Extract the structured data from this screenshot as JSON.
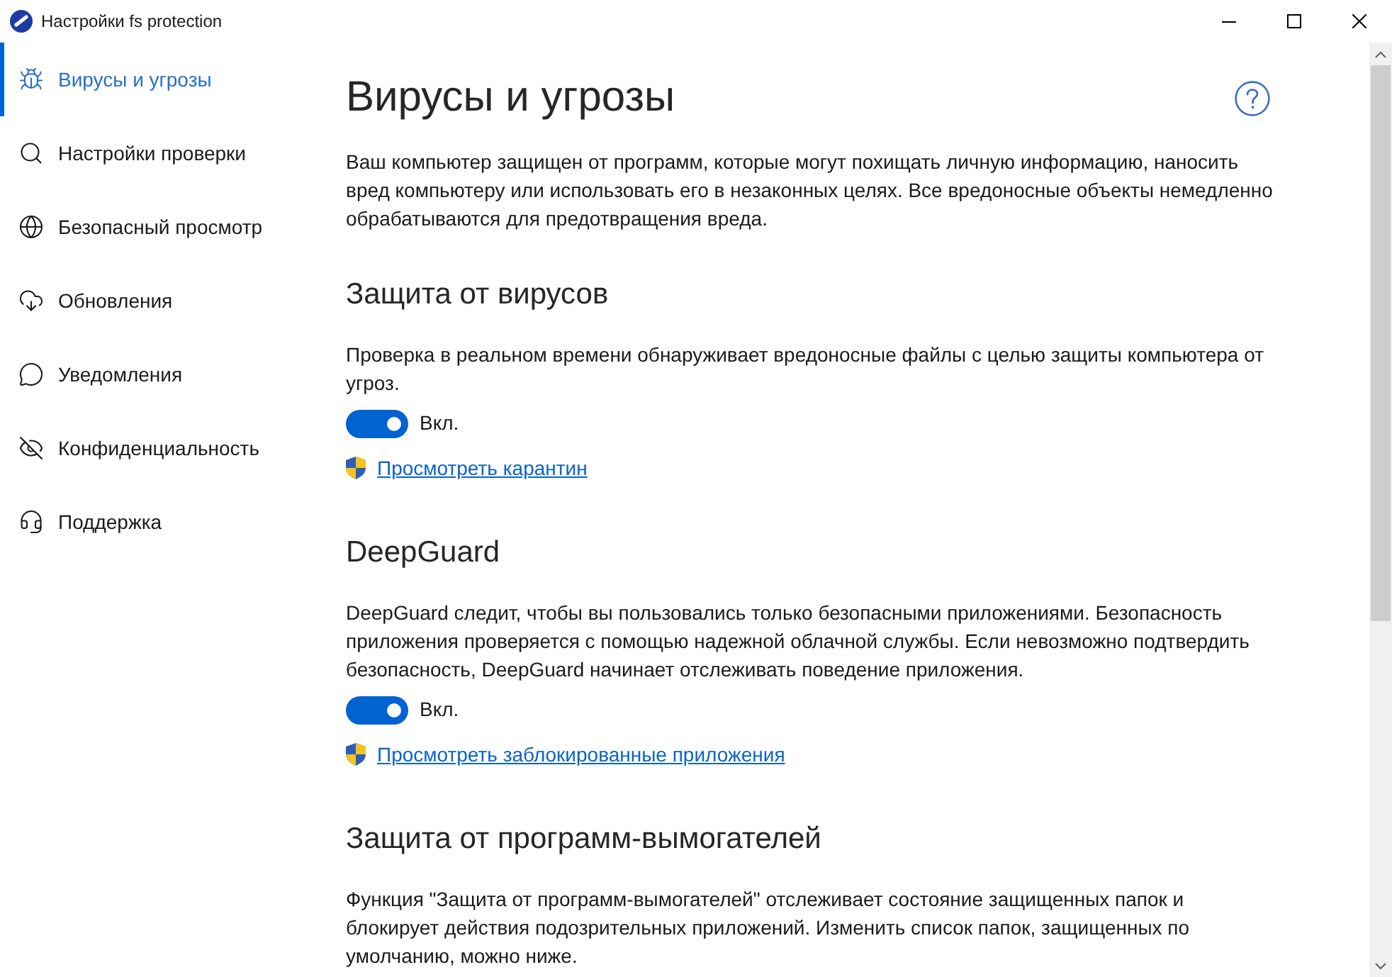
{
  "window": {
    "title": "Настройки fs protection"
  },
  "sidebar": {
    "items": [
      {
        "label": "Вирусы и угрозы",
        "selected": true
      },
      {
        "label": "Настройки проверки",
        "selected": false
      },
      {
        "label": "Безопасный просмотр",
        "selected": false
      },
      {
        "label": "Обновления",
        "selected": false
      },
      {
        "label": "Уведомления",
        "selected": false
      },
      {
        "label": "Конфиденциальность",
        "selected": false
      },
      {
        "label": "Поддержка",
        "selected": false
      }
    ]
  },
  "page": {
    "title": "Вирусы и угрозы",
    "description": "Ваш компьютер защищен от программ, которые могут похищать личную информацию, наносить вред компьютеру или использовать его в незаконных целях. Все вредоносные объекты немедленно обрабатываются для предотвращения вреда."
  },
  "sections": [
    {
      "title": "Защита от вирусов",
      "description": "Проверка в реальном времени обнаруживает вредоносные файлы с целью защиты компьютера от угроз.",
      "toggle": {
        "on": true,
        "label": "Вкл."
      },
      "link": "Просмотреть карантин"
    },
    {
      "title": "DeepGuard",
      "description": "DeepGuard следит, чтобы вы пользовались только безопасными приложениями. Безопасность приложения проверяется с помощью надежной облачной службы. Если невозможно подтвердить безопасность, DeepGuard начинает отслеживать поведение приложения.",
      "toggle": {
        "on": true,
        "label": "Вкл."
      },
      "link": "Просмотреть заблокированные приложения"
    },
    {
      "title": "Защита от программ-вымогателей",
      "description": "Функция \"Защита от программ-вымогателей\" отслеживает состояние защищенных папок и блокирует действия подозрительных приложений. Изменить список папок, защищенных по умолчанию, можно ниже."
    }
  ]
}
